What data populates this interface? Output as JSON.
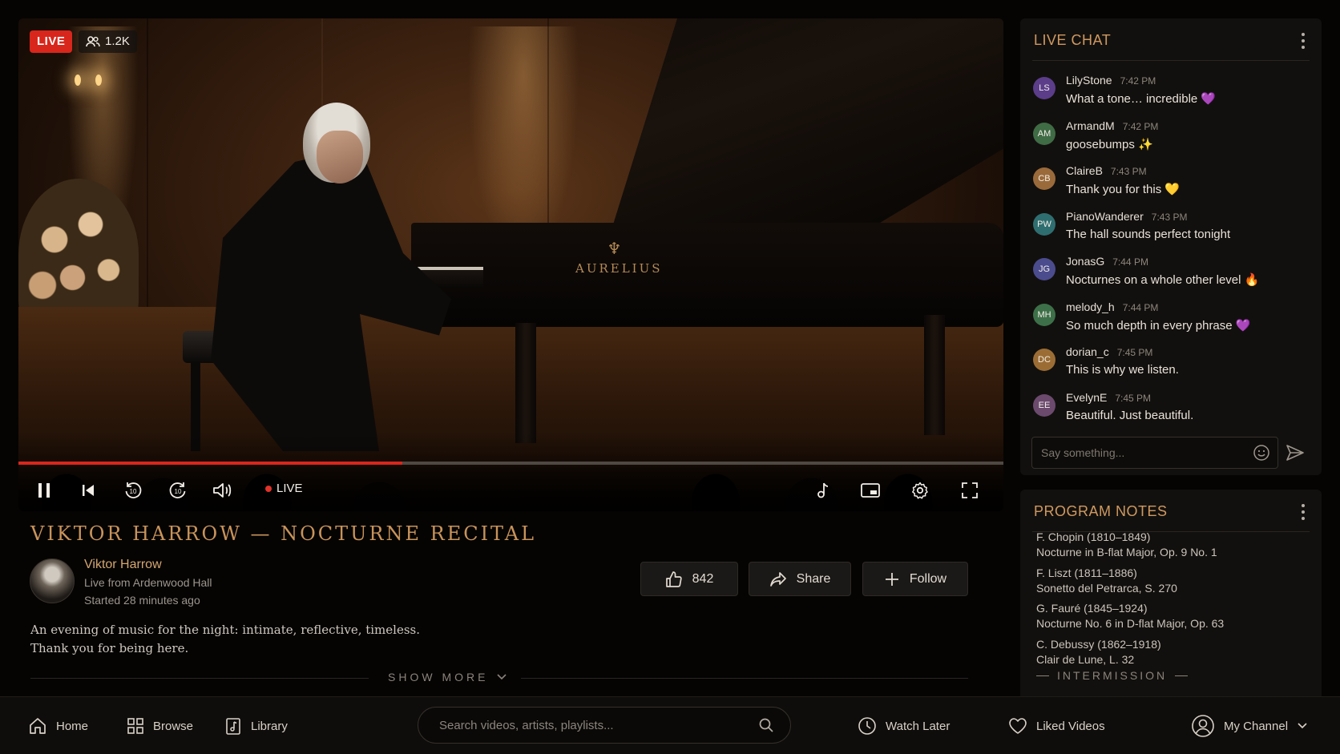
{
  "player": {
    "live_badge": "LIVE",
    "viewer_count": "1.2K",
    "live_indicator": "LIVE",
    "progress": 0.39,
    "piano_brand": "AURELIUS"
  },
  "video": {
    "title": "VIKTOR HARROW — NOCTURNE RECITAL",
    "channel_name": "Viktor Harrow",
    "venue": "Live from Ardenwood Hall",
    "started": "Started 28 minutes ago",
    "description_line1": "An evening of music for the night: intimate, reflective, timeless.",
    "description_line2": "Thank you for being here.",
    "show_more": "SHOW MORE",
    "like_count": "842",
    "share_label": "Share",
    "follow_label": "Follow"
  },
  "chat": {
    "title": "LIVE CHAT",
    "input_placeholder": "Say something...",
    "messages": [
      {
        "initials": "LS",
        "user": "LilyStone",
        "time": "7:42 PM",
        "text": "What a tone… incredible 💜",
        "color": "#5b3d8a"
      },
      {
        "initials": "AM",
        "user": "ArmandM",
        "time": "7:42 PM",
        "text": "goosebumps ✨",
        "color": "#3f6b45"
      },
      {
        "initials": "CB",
        "user": "ClaireB",
        "time": "7:43 PM",
        "text": "Thank you for this 💛",
        "color": "#9a6a3a"
      },
      {
        "initials": "PW",
        "user": "PianoWanderer",
        "time": "7:43 PM",
        "text": "The hall sounds perfect tonight",
        "color": "#2f6e70"
      },
      {
        "initials": "JG",
        "user": "JonasG",
        "time": "7:44 PM",
        "text": "Nocturnes on a whole other level 🔥",
        "color": "#4b4c8e"
      },
      {
        "initials": "MH",
        "user": "melody_h",
        "time": "7:44 PM",
        "text": "So much depth in every phrase 💜",
        "color": "#3d7048"
      },
      {
        "initials": "DC",
        "user": "dorian_c",
        "time": "7:45 PM",
        "text": "This is why we listen.",
        "color": "#9b6d35"
      },
      {
        "initials": "EE",
        "user": "EvelynE",
        "time": "7:45 PM",
        "text": "Beautiful. Just beautiful.",
        "color": "#6b4a6e"
      }
    ]
  },
  "program": {
    "title": "PROGRAM NOTES",
    "pieces": [
      {
        "composer": "F. Chopin (1810–1849)",
        "work": "Nocturne in B-flat Major, Op. 9 No. 1"
      },
      {
        "composer": "F. Liszt (1811–1886)",
        "work": "Sonetto del Petrarca, S. 270"
      },
      {
        "composer": "G. Fauré (1845–1924)",
        "work": "Nocturne No. 6 in D-flat Major, Op. 63"
      },
      {
        "composer": "C. Debussy (1862–1918)",
        "work": "Clair de Lune, L. 32"
      }
    ],
    "intermission": "INTERMISSION"
  },
  "nav": {
    "home": "Home",
    "browse": "Browse",
    "library": "Library",
    "search_placeholder": "Search videos, artists, playlists...",
    "watch_later": "Watch Later",
    "liked_videos": "Liked Videos",
    "my_channel": "My Channel"
  },
  "colors": {
    "accent": "#cf9960",
    "live_red": "#d9261c",
    "background": "#050403"
  }
}
